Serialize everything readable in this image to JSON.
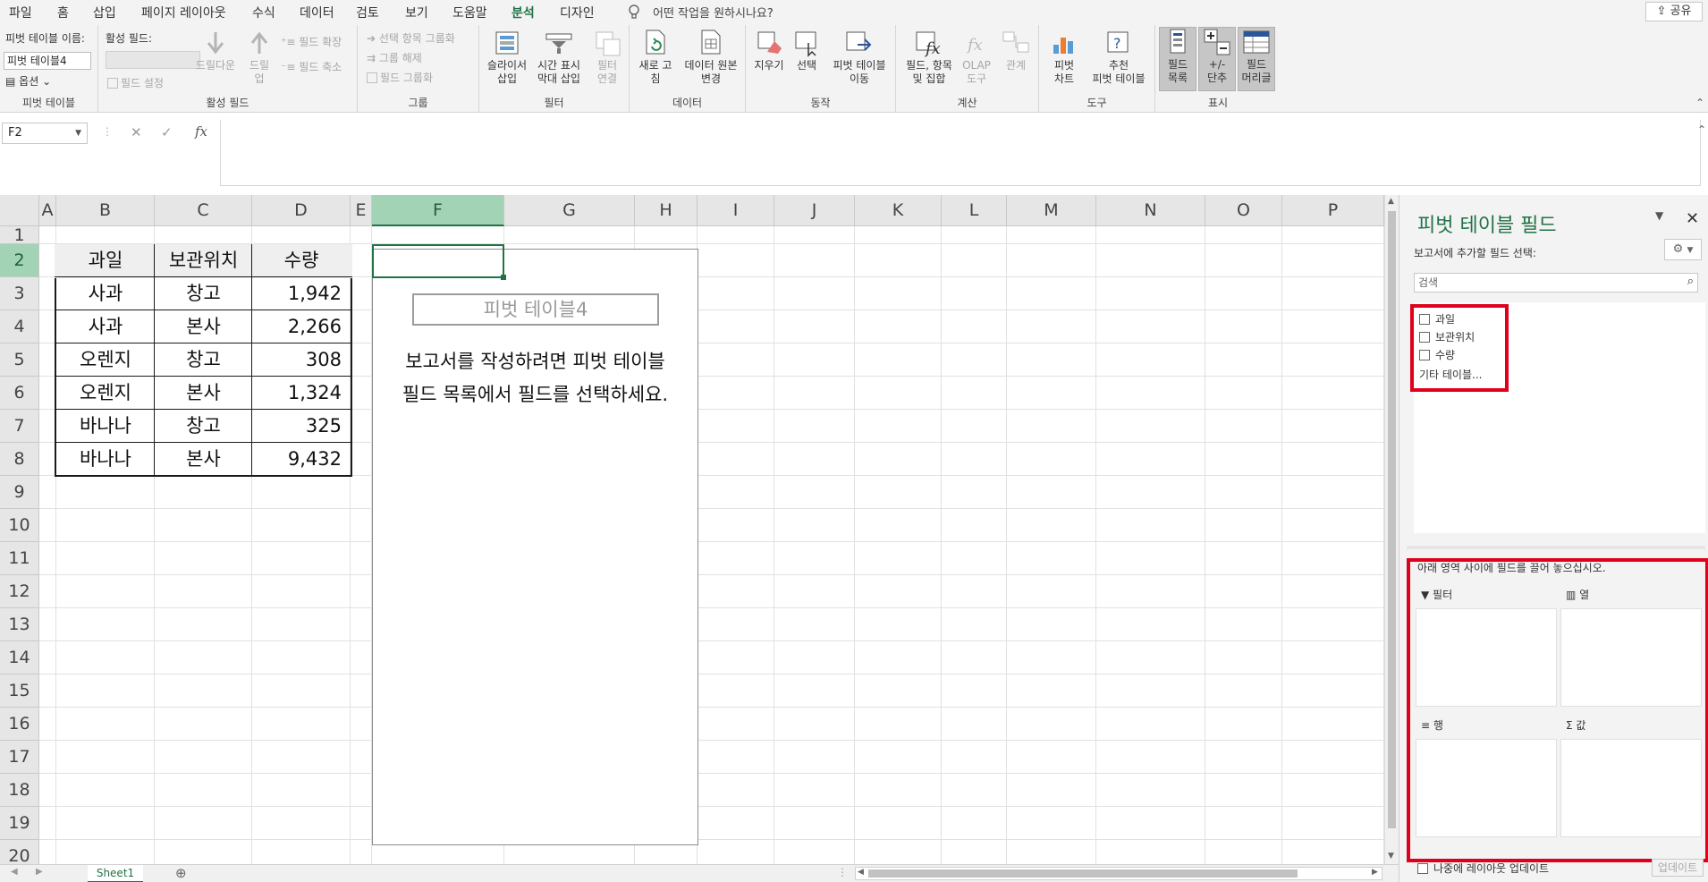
{
  "menu": {
    "items": [
      "파일",
      "홈",
      "삽입",
      "페이지 레이아웃",
      "수식",
      "데이터",
      "검토",
      "보기",
      "도움말",
      "분석",
      "디자인"
    ],
    "active": "분석",
    "tell_me": "어떤 작업을 원하시나요?",
    "share": "공유"
  },
  "ribbon": {
    "pivot_group": {
      "name_label": "피벗 테이블 이름:",
      "name_value": "피벗 테이블4",
      "options": "옵션",
      "label": "피벗 테이블"
    },
    "active_field_group": {
      "label_field": "활성 필드:",
      "field_settings": "필드 설정",
      "drill_down": "드릴다운",
      "drill_up_1": "드릴",
      "drill_up_2": "업",
      "expand": "필드 확장",
      "collapse": "필드 축소",
      "label": "활성 필드"
    },
    "group_group": {
      "group_selection": "선택 항목 그룹화",
      "ungroup": "그룹 해제",
      "group_field": "필드 그룹화",
      "label": "그룹"
    },
    "filter_group": {
      "slicer_1": "슬라이서",
      "slicer_2": "삽입",
      "timeline_1": "시간 표시",
      "timeline_2": "막대 삽입",
      "filter_conn_1": "필터",
      "filter_conn_2": "연결",
      "label": "필터"
    },
    "data_group": {
      "refresh_1": "새로 고",
      "refresh_2": "침",
      "change_source_1": "데이터 원본",
      "change_source_2": "변경",
      "label": "데이터"
    },
    "action_group": {
      "clear": "지우기",
      "select": "선택",
      "move_1": "피벗 테이블",
      "move_2": "이동",
      "label": "동작"
    },
    "calc_group": {
      "fields_1": "필드, 항목",
      "fields_2": "및 집합",
      "olap_1": "OLAP",
      "olap_2": "도구",
      "relations": "관계",
      "label": "계산"
    },
    "tools_group": {
      "pivotchart_1": "피벗",
      "pivotchart_2": "차트",
      "recommended_1": "추천",
      "recommended_2": "피벗 테이블",
      "label": "도구"
    },
    "show_group": {
      "field_list_1": "필드",
      "field_list_2": "목록",
      "buttons_1": "+/-",
      "buttons_2": "단추",
      "headers_1": "필드",
      "headers_2": "머리글",
      "label": "표시"
    }
  },
  "formula_bar": {
    "name_box": "F2",
    "formula": ""
  },
  "sheet": {
    "columns": [
      "A",
      "B",
      "C",
      "D",
      "E",
      "F",
      "G",
      "H",
      "I",
      "J",
      "K",
      "L",
      "M",
      "N",
      "O",
      "P"
    ],
    "rows": [
      "1",
      "2",
      "3",
      "4",
      "5",
      "6",
      "7",
      "8",
      "9",
      "10",
      "11",
      "12",
      "13",
      "14",
      "15",
      "16",
      "17",
      "18",
      "19",
      "20"
    ],
    "table_headers": [
      "과일",
      "보관위치",
      "수량"
    ],
    "table_rows": [
      [
        "사과",
        "창고",
        "1,942"
      ],
      [
        "사과",
        "본사",
        "2,266"
      ],
      [
        "오렌지",
        "창고",
        "308"
      ],
      [
        "오렌지",
        "본사",
        "1,324"
      ],
      [
        "바나나",
        "창고",
        "325"
      ],
      [
        "바나나",
        "본사",
        "9,432"
      ]
    ],
    "pivot_name": "피벗 테이블4",
    "pivot_msg_line1": "보고서를 작성하려면 피벗 테이블",
    "pivot_msg_line2": "필드 목록에서 필드를 선택하세요.",
    "sheet_tab": "Sheet1"
  },
  "field_panel": {
    "title": "피벗 테이블 필드",
    "choose_label": "보고서에 추가할 필드 선택:",
    "search_placeholder": "검색",
    "fields": [
      "과일",
      "보관위치",
      "수량"
    ],
    "more_tables": "기타 테이블...",
    "drag_label": "아래 영역 사이에 필드를 끌어 놓으십시오.",
    "areas": {
      "filter": "필터",
      "columns": "열",
      "rows": "행",
      "values": "값"
    },
    "defer_label": "나중에 레이아웃 업데이트",
    "update_button": "업데이트"
  },
  "colors": {
    "accent": "#217346",
    "highlight": "#e0001b",
    "selected_header": "#a2d3b4"
  }
}
